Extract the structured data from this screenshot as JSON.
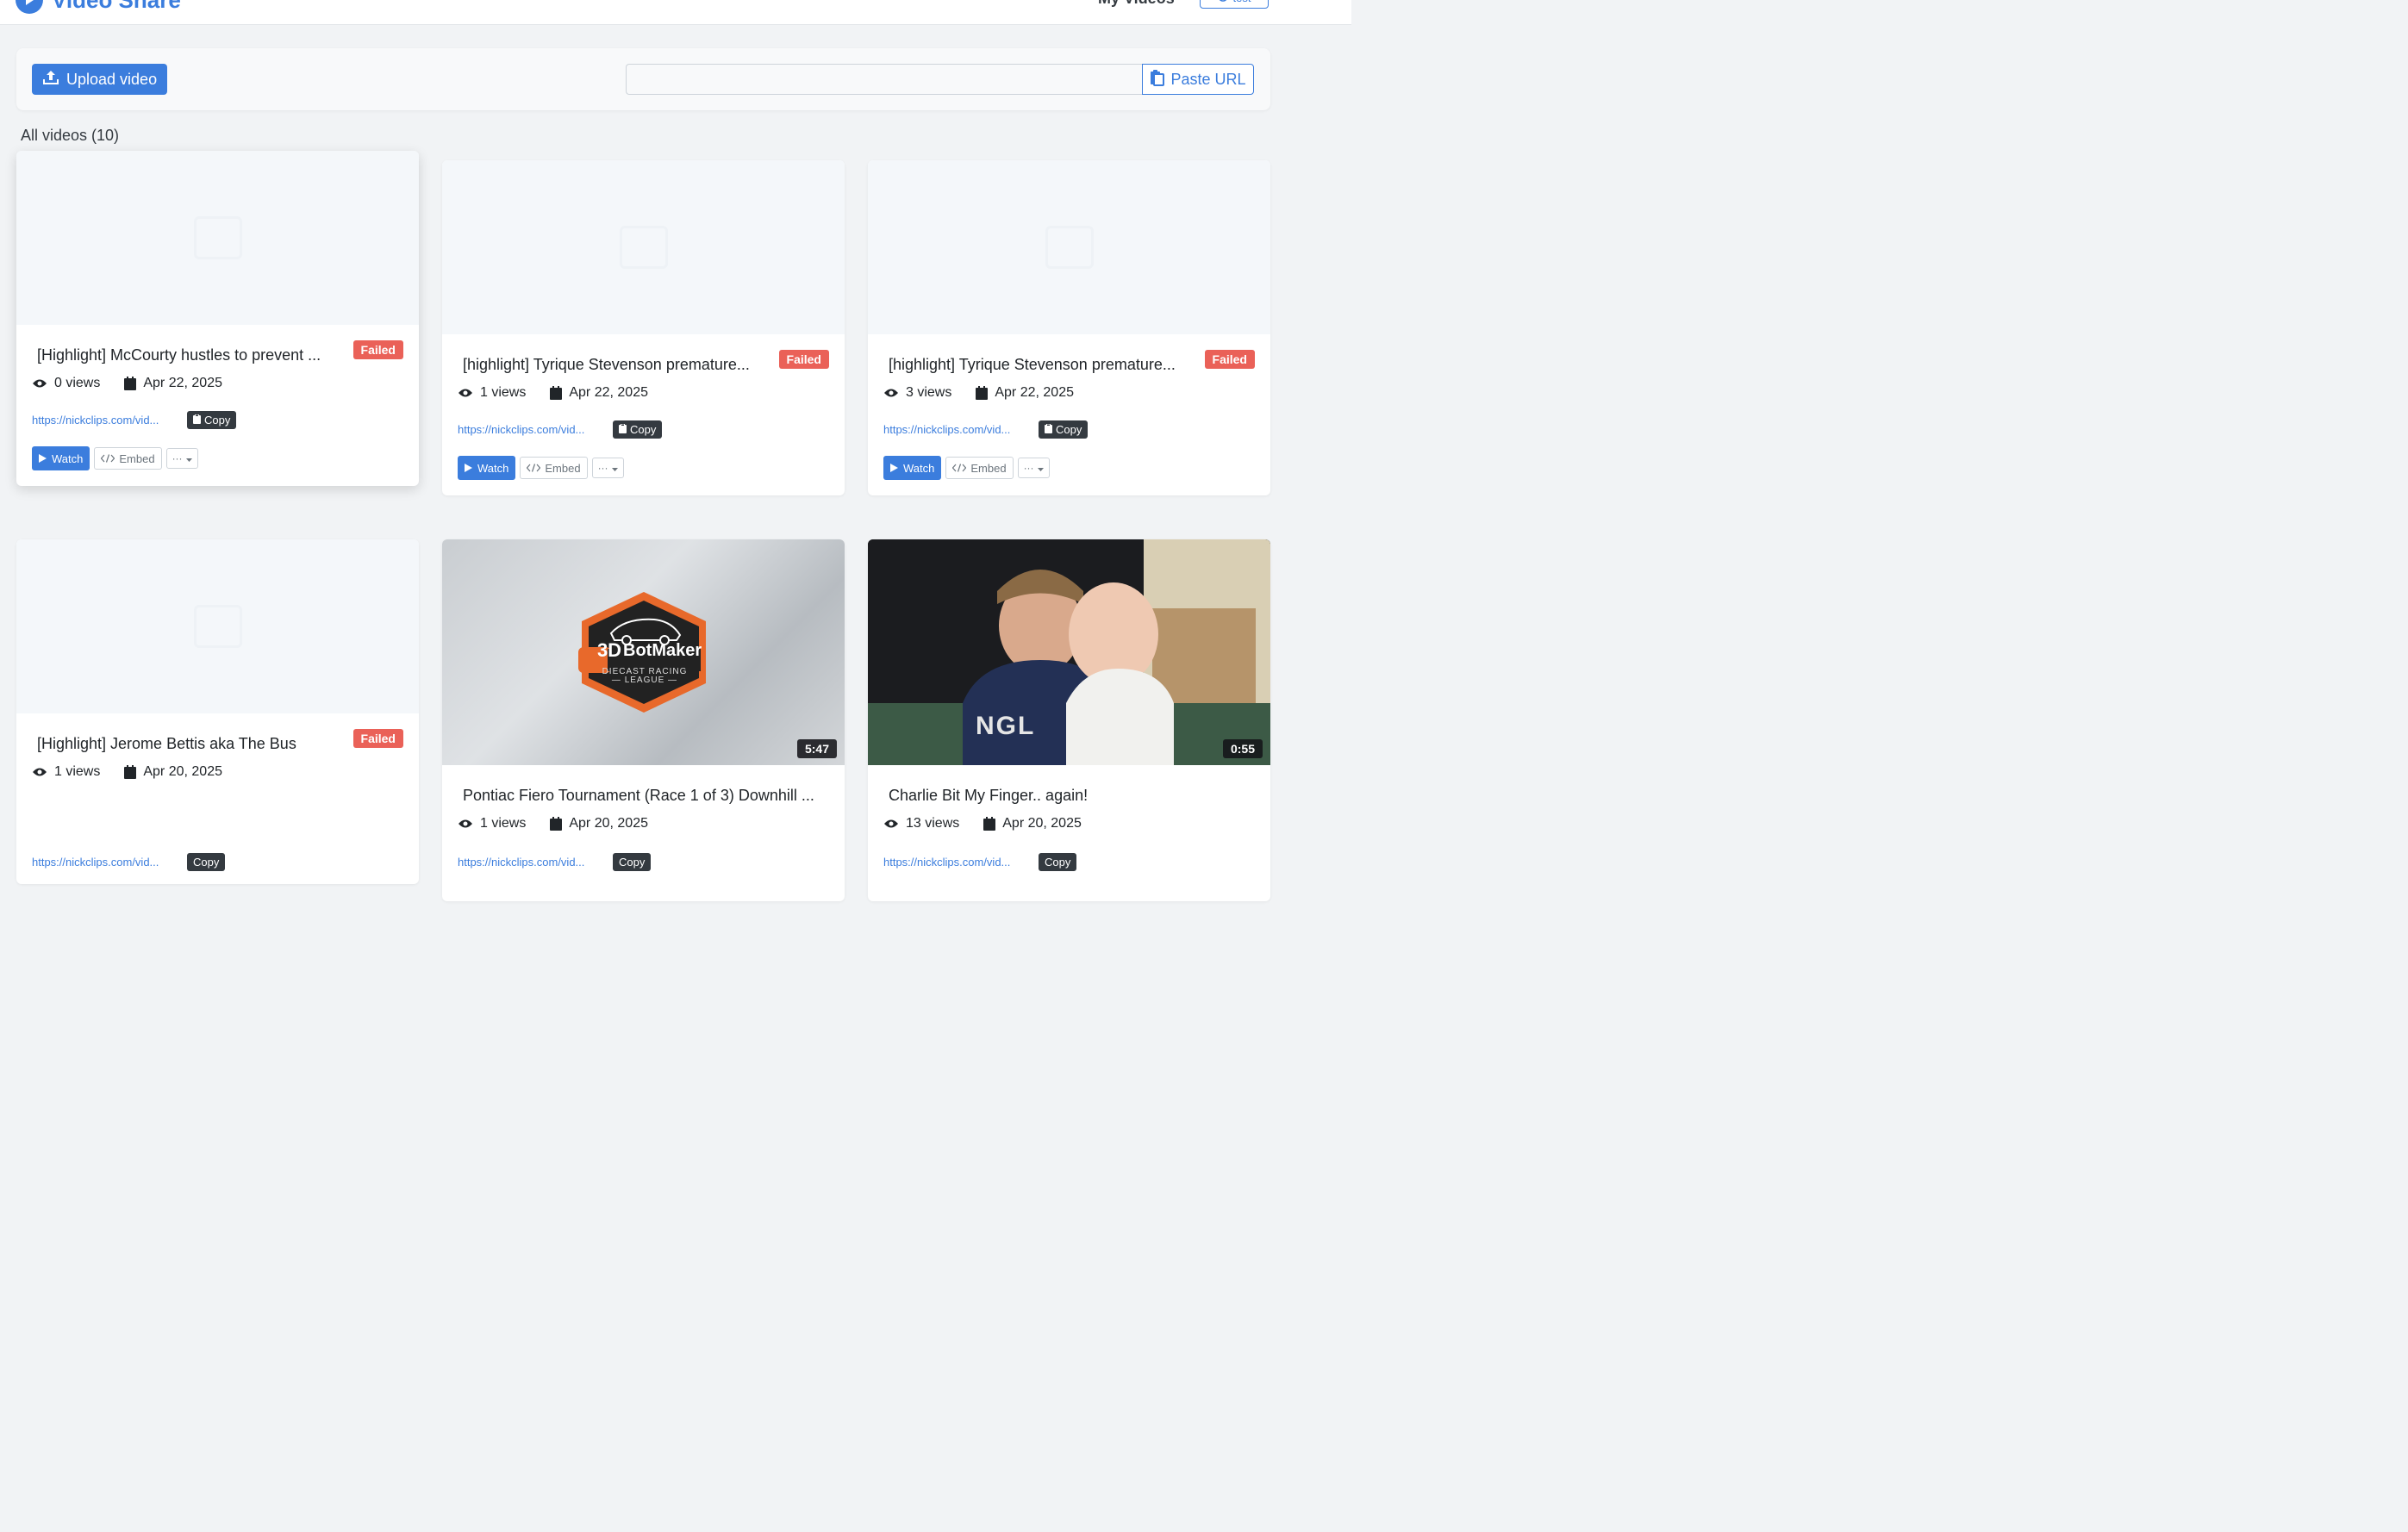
{
  "header": {
    "brand": "Video Share",
    "nav_my_videos": "My Videos",
    "user_label": "test"
  },
  "toolbar": {
    "upload_label": "Upload video",
    "url_value": "",
    "paste_label": "Paste URL"
  },
  "section": {
    "title": "All videos (10)"
  },
  "colors": {
    "accent": "#3b7ddd",
    "failed": "#ea6158",
    "dark": "#343a40"
  },
  "videos": [
    {
      "title": "[Highlight] McCourty hustles to prevent ...",
      "status": "Failed",
      "views": "0 views",
      "date": "Apr 22, 2025",
      "link": "https://nickclips.com/vid...",
      "copy": "Copy",
      "watch": "Watch",
      "embed": "Embed",
      "more": "···"
    },
    {
      "title": "[highlight] Tyrique Stevenson premature...",
      "status": "Failed",
      "views": "1 views",
      "date": "Apr 22, 2025",
      "link": "https://nickclips.com/vid...",
      "copy": "Copy",
      "watch": "Watch",
      "embed": "Embed",
      "more": "···"
    },
    {
      "title": "[highlight] Tyrique Stevenson premature...",
      "status": "Failed",
      "views": "3 views",
      "date": "Apr 22, 2025",
      "link": "https://nickclips.com/vid...",
      "copy": "Copy",
      "watch": "Watch",
      "embed": "Embed",
      "more": "···"
    },
    {
      "title": "[Highlight] Jerome Bettis aka The Bus",
      "status": "Failed",
      "views": "1 views",
      "date": "Apr 20, 2025",
      "link": "https://nickclips.com/vid...",
      "copy": "Copy"
    },
    {
      "title": "Pontiac Fiero Tournament (Race 1 of 3) Downhill ...",
      "duration": "5:47",
      "views": "1 views",
      "date": "Apr 20, 2025",
      "link": "https://nickclips.com/vid...",
      "copy": "Copy",
      "logo_top": "3D",
      "logo_main": "BotMaker",
      "logo_sub1": "DIECAST RACING",
      "logo_sub2": "— LEAGUE —"
    },
    {
      "title": "Charlie Bit My Finger.. again!",
      "duration": "0:55",
      "views": "13 views",
      "date": "Apr 20, 2025",
      "link": "https://nickclips.com/vid...",
      "copy": "Copy",
      "shirt_text": "NGL"
    }
  ]
}
